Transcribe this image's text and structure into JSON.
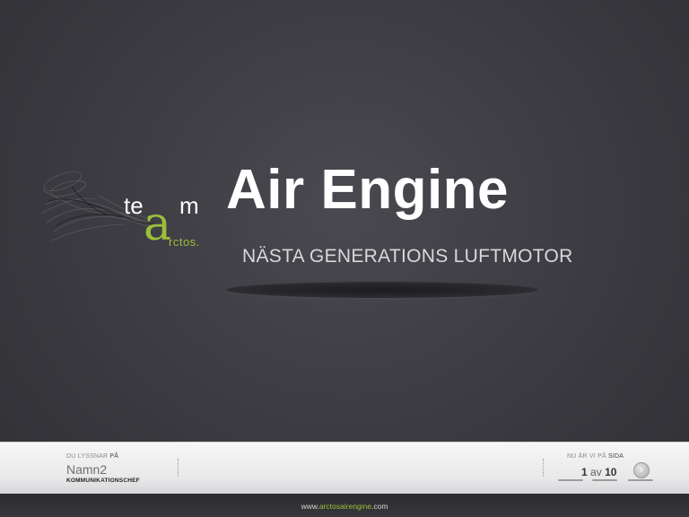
{
  "slide": {
    "title": "Air Engine",
    "subtitle": "NÄSTA GENERATIONS LUFTMOTOR"
  },
  "logo": {
    "te": "te",
    "a": "a",
    "m": "m",
    "rctos": "rctos."
  },
  "footer": {
    "listen_label_dim": "DU LYSSNAR",
    "listen_label_strong": "PÅ",
    "speaker_name": "Namn2",
    "speaker_role": "KOMMUNIKATIONSCHEF",
    "page_label_dim": "NU ÄR VI PÅ",
    "page_label_strong": "SIDA",
    "current_page": "1",
    "page_separator": "av",
    "total_pages": "10",
    "next_icon": "chevron-right-icon"
  },
  "website": {
    "prefix": "www.",
    "domain": "arctosairengine",
    "suffix": ".com"
  },
  "colors": {
    "accent": "#9cbf3b",
    "background": "#3b3a40"
  }
}
